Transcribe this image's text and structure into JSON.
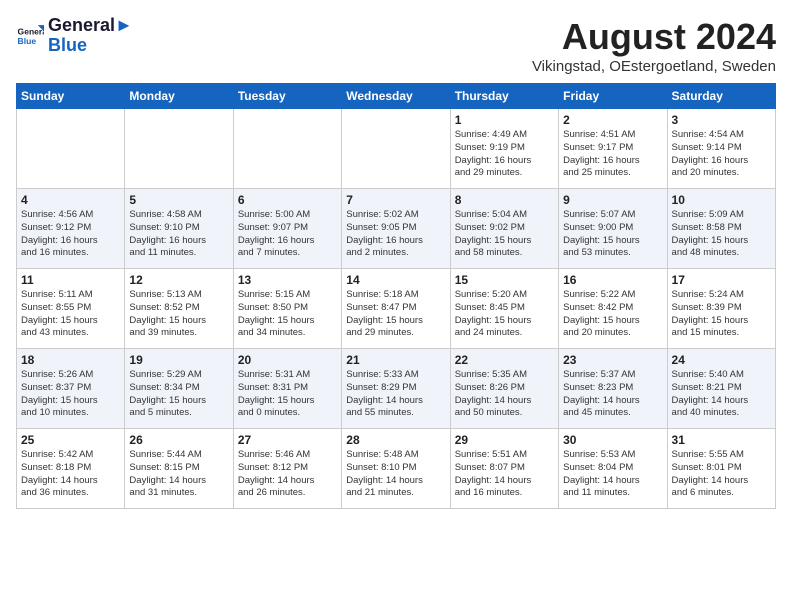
{
  "header": {
    "logo_line1": "General",
    "logo_line2": "Blue",
    "month_title": "August 2024",
    "subtitle": "Vikingstad, OEstergoetland, Sweden"
  },
  "weekdays": [
    "Sunday",
    "Monday",
    "Tuesday",
    "Wednesday",
    "Thursday",
    "Friday",
    "Saturday"
  ],
  "weeks": [
    [
      {
        "day": "",
        "content": ""
      },
      {
        "day": "",
        "content": ""
      },
      {
        "day": "",
        "content": ""
      },
      {
        "day": "",
        "content": ""
      },
      {
        "day": "1",
        "content": "Sunrise: 4:49 AM\nSunset: 9:19 PM\nDaylight: 16 hours\nand 29 minutes."
      },
      {
        "day": "2",
        "content": "Sunrise: 4:51 AM\nSunset: 9:17 PM\nDaylight: 16 hours\nand 25 minutes."
      },
      {
        "day": "3",
        "content": "Sunrise: 4:54 AM\nSunset: 9:14 PM\nDaylight: 16 hours\nand 20 minutes."
      }
    ],
    [
      {
        "day": "4",
        "content": "Sunrise: 4:56 AM\nSunset: 9:12 PM\nDaylight: 16 hours\nand 16 minutes."
      },
      {
        "day": "5",
        "content": "Sunrise: 4:58 AM\nSunset: 9:10 PM\nDaylight: 16 hours\nand 11 minutes."
      },
      {
        "day": "6",
        "content": "Sunrise: 5:00 AM\nSunset: 9:07 PM\nDaylight: 16 hours\nand 7 minutes."
      },
      {
        "day": "7",
        "content": "Sunrise: 5:02 AM\nSunset: 9:05 PM\nDaylight: 16 hours\nand 2 minutes."
      },
      {
        "day": "8",
        "content": "Sunrise: 5:04 AM\nSunset: 9:02 PM\nDaylight: 15 hours\nand 58 minutes."
      },
      {
        "day": "9",
        "content": "Sunrise: 5:07 AM\nSunset: 9:00 PM\nDaylight: 15 hours\nand 53 minutes."
      },
      {
        "day": "10",
        "content": "Sunrise: 5:09 AM\nSunset: 8:58 PM\nDaylight: 15 hours\nand 48 minutes."
      }
    ],
    [
      {
        "day": "11",
        "content": "Sunrise: 5:11 AM\nSunset: 8:55 PM\nDaylight: 15 hours\nand 43 minutes."
      },
      {
        "day": "12",
        "content": "Sunrise: 5:13 AM\nSunset: 8:52 PM\nDaylight: 15 hours\nand 39 minutes."
      },
      {
        "day": "13",
        "content": "Sunrise: 5:15 AM\nSunset: 8:50 PM\nDaylight: 15 hours\nand 34 minutes."
      },
      {
        "day": "14",
        "content": "Sunrise: 5:18 AM\nSunset: 8:47 PM\nDaylight: 15 hours\nand 29 minutes."
      },
      {
        "day": "15",
        "content": "Sunrise: 5:20 AM\nSunset: 8:45 PM\nDaylight: 15 hours\nand 24 minutes."
      },
      {
        "day": "16",
        "content": "Sunrise: 5:22 AM\nSunset: 8:42 PM\nDaylight: 15 hours\nand 20 minutes."
      },
      {
        "day": "17",
        "content": "Sunrise: 5:24 AM\nSunset: 8:39 PM\nDaylight: 15 hours\nand 15 minutes."
      }
    ],
    [
      {
        "day": "18",
        "content": "Sunrise: 5:26 AM\nSunset: 8:37 PM\nDaylight: 15 hours\nand 10 minutes."
      },
      {
        "day": "19",
        "content": "Sunrise: 5:29 AM\nSunset: 8:34 PM\nDaylight: 15 hours\nand 5 minutes."
      },
      {
        "day": "20",
        "content": "Sunrise: 5:31 AM\nSunset: 8:31 PM\nDaylight: 15 hours\nand 0 minutes."
      },
      {
        "day": "21",
        "content": "Sunrise: 5:33 AM\nSunset: 8:29 PM\nDaylight: 14 hours\nand 55 minutes."
      },
      {
        "day": "22",
        "content": "Sunrise: 5:35 AM\nSunset: 8:26 PM\nDaylight: 14 hours\nand 50 minutes."
      },
      {
        "day": "23",
        "content": "Sunrise: 5:37 AM\nSunset: 8:23 PM\nDaylight: 14 hours\nand 45 minutes."
      },
      {
        "day": "24",
        "content": "Sunrise: 5:40 AM\nSunset: 8:21 PM\nDaylight: 14 hours\nand 40 minutes."
      }
    ],
    [
      {
        "day": "25",
        "content": "Sunrise: 5:42 AM\nSunset: 8:18 PM\nDaylight: 14 hours\nand 36 minutes."
      },
      {
        "day": "26",
        "content": "Sunrise: 5:44 AM\nSunset: 8:15 PM\nDaylight: 14 hours\nand 31 minutes."
      },
      {
        "day": "27",
        "content": "Sunrise: 5:46 AM\nSunset: 8:12 PM\nDaylight: 14 hours\nand 26 minutes."
      },
      {
        "day": "28",
        "content": "Sunrise: 5:48 AM\nSunset: 8:10 PM\nDaylight: 14 hours\nand 21 minutes."
      },
      {
        "day": "29",
        "content": "Sunrise: 5:51 AM\nSunset: 8:07 PM\nDaylight: 14 hours\nand 16 minutes."
      },
      {
        "day": "30",
        "content": "Sunrise: 5:53 AM\nSunset: 8:04 PM\nDaylight: 14 hours\nand 11 minutes."
      },
      {
        "day": "31",
        "content": "Sunrise: 5:55 AM\nSunset: 8:01 PM\nDaylight: 14 hours\nand 6 minutes."
      }
    ]
  ]
}
